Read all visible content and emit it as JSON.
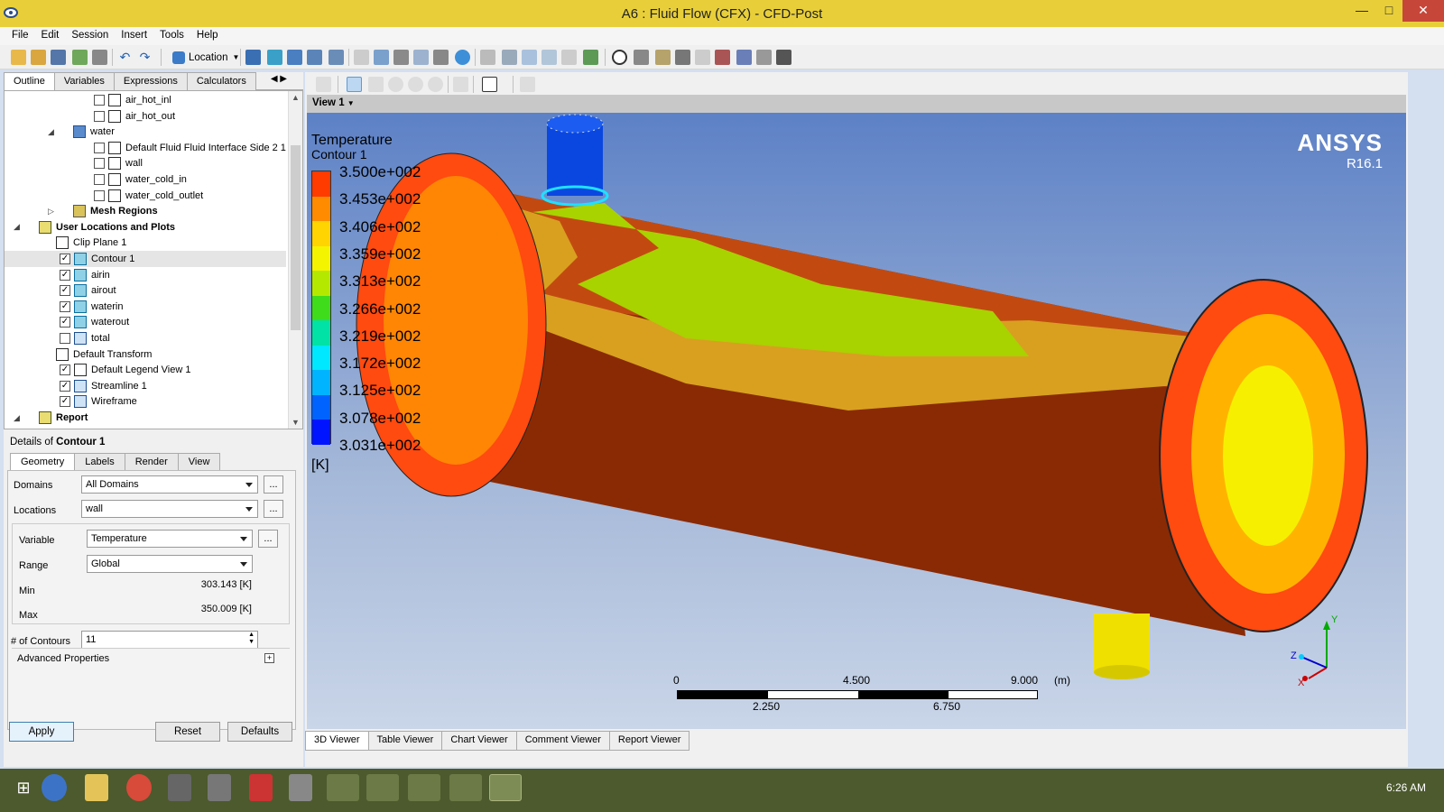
{
  "window": {
    "title": "A6 : Fluid Flow (CFX) - CFD-Post",
    "minimize": "—",
    "maximize": "□",
    "close": "✕"
  },
  "menu": [
    "File",
    "Edit",
    "Session",
    "Insert",
    "Tools",
    "Help"
  ],
  "toolbar": {
    "location_label": "Location"
  },
  "left_tabs": [
    "Outline",
    "Variables",
    "Expressions",
    "Calculators"
  ],
  "tree": [
    {
      "label": "air_hot_inl",
      "indent": 3,
      "checkbox": false,
      "icon": "boundary"
    },
    {
      "label": "air_hot_out",
      "indent": 3,
      "checkbox": false,
      "icon": "boundary"
    },
    {
      "label": "water",
      "indent": 2,
      "icon": "domain",
      "expander": "◢"
    },
    {
      "label": "Default Fluid Fluid Interface Side 2 1",
      "indent": 3,
      "checkbox": false,
      "icon": "boundary"
    },
    {
      "label": "wall",
      "indent": 3,
      "checkbox": false,
      "icon": "boundary"
    },
    {
      "label": "water_cold_in",
      "indent": 3,
      "checkbox": false,
      "icon": "boundary"
    },
    {
      "label": "water_cold_outlet",
      "indent": 3,
      "checkbox": false,
      "icon": "boundary"
    },
    {
      "label": "Mesh Regions",
      "indent": 2,
      "icon": "mesh",
      "bold": true,
      "expander": "▷"
    },
    {
      "label": "User Locations and Plots",
      "indent": 0,
      "icon": "locations",
      "bold": true,
      "expander": "◢"
    },
    {
      "label": "Clip Plane 1",
      "indent": 1,
      "icon": "clip"
    },
    {
      "label": "Contour 1",
      "indent": 1,
      "checkbox": true,
      "icon": "contour",
      "selected": true
    },
    {
      "label": "airin",
      "indent": 1,
      "checkbox": true,
      "icon": "contour"
    },
    {
      "label": "airout",
      "indent": 1,
      "checkbox": true,
      "icon": "contour"
    },
    {
      "label": "waterin",
      "indent": 1,
      "checkbox": true,
      "icon": "contour"
    },
    {
      "label": "waterout",
      "indent": 1,
      "checkbox": true,
      "icon": "contour"
    },
    {
      "label": "total",
      "indent": 1,
      "checkbox": false,
      "icon": "volume"
    },
    {
      "label": "Default Transform",
      "indent": 1,
      "icon": "transform"
    },
    {
      "label": "Default Legend View 1",
      "indent": 1,
      "checkbox": true,
      "icon": "legend"
    },
    {
      "label": "Streamline 1",
      "indent": 1,
      "checkbox": true,
      "icon": "streamline"
    },
    {
      "label": "Wireframe",
      "indent": 1,
      "checkbox": true,
      "icon": "wireframe"
    },
    {
      "label": "Report",
      "indent": 0,
      "icon": "report",
      "bold": true,
      "expander": "◢"
    }
  ],
  "details": {
    "title_prefix": "Details of ",
    "title_object": "Contour 1",
    "tabs": [
      "Geometry",
      "Labels",
      "Render",
      "View"
    ],
    "domains_label": "Domains",
    "domains_value": "All Domains",
    "locations_label": "Locations",
    "locations_value": "wall",
    "variable_label": "Variable",
    "variable_value": "Temperature",
    "range_label": "Range",
    "range_value": "Global",
    "min_label": "Min",
    "min_value": "303.143 [K]",
    "max_label": "Max",
    "max_value": "350.009 [K]",
    "contours_label": "# of Contours",
    "contours_value": "11",
    "advanced_label": "Advanced Properties",
    "ellipsis": "...",
    "apply": "Apply",
    "reset": "Reset",
    "defaults": "Defaults"
  },
  "viewer": {
    "view_label": "View 1",
    "legend_title": "Temperature",
    "legend_subtitle": "Contour 1",
    "legend_values": [
      "3.500e+002",
      "3.453e+002",
      "3.406e+002",
      "3.359e+002",
      "3.313e+002",
      "3.266e+002",
      "3.219e+002",
      "3.172e+002",
      "3.125e+002",
      "3.078e+002",
      "3.031e+002"
    ],
    "legend_colors": [
      "#ff3b00",
      "#ff8c00",
      "#ffd400",
      "#f4f400",
      "#b5e800",
      "#3fdc1c",
      "#00e2a6",
      "#00e8ff",
      "#00b4ff",
      "#0062ff",
      "#0014ff"
    ],
    "legend_unit": "[K]",
    "brand": "ANSYS",
    "version": "R16.1",
    "scale_top": [
      "0",
      "4.500",
      "9.000"
    ],
    "scale_unit": "(m)",
    "scale_bottom": [
      "2.250",
      "6.750"
    ],
    "axis_y": "Y",
    "axis_z": "Z",
    "axis_x": "X",
    "tabs": [
      "3D Viewer",
      "Table Viewer",
      "Chart Viewer",
      "Comment Viewer",
      "Report Viewer"
    ]
  },
  "taskbar": {
    "time": "6:26 AM"
  }
}
